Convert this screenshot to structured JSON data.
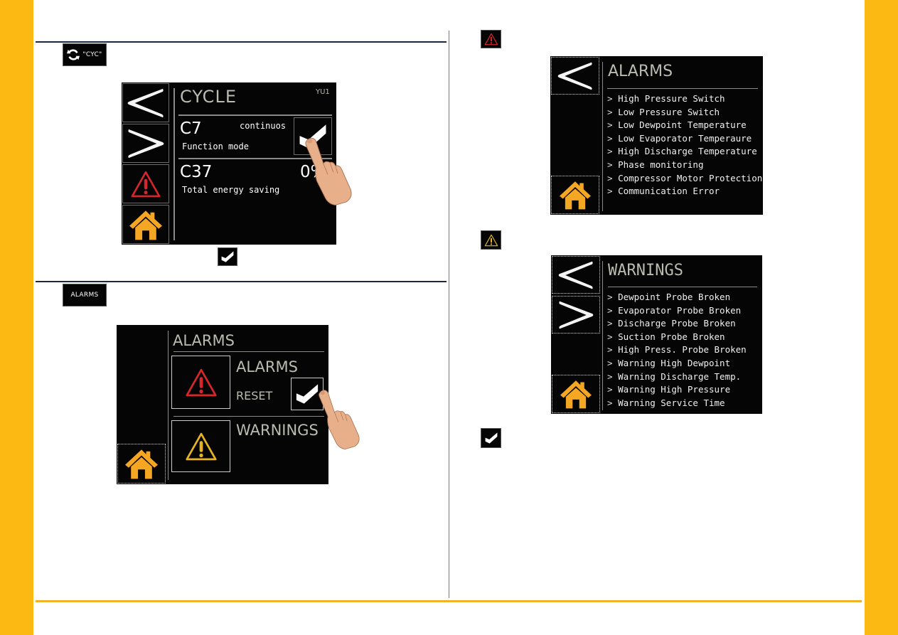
{
  "colors": {
    "accent_yellow": "#fdb913",
    "divider_navy": "#1b2842",
    "alarm_red": "#d8262c",
    "warning_yellow": "#e6b422",
    "home_amber": "#f5a623",
    "screen_bg": "#050505",
    "title_gray": "#b9bcae"
  },
  "section_cycle": {
    "chip_icon": "refresh-icon",
    "chip_label": "\"CYC\"",
    "screen": {
      "title": "CYCLE",
      "unit_id": "YU1",
      "rows": [
        {
          "code": "C7",
          "value": "continuos",
          "description": "Function mode"
        },
        {
          "code": "C37",
          "value": "0%",
          "description": "Total energy saving"
        }
      ],
      "nav_buttons": [
        "back-arrow-icon",
        "forward-arrow-icon",
        "alarm-triangle-icon",
        "home-icon"
      ],
      "confirm_icon": "checkmark-icon"
    },
    "confirm_chip_icon": "checkmark-icon"
  },
  "section_alarms": {
    "chip_label": "ALARMS",
    "screen": {
      "title": "ALARMS",
      "alarms_label": "ALARMS",
      "reset_label": "RESET",
      "warnings_label": "WARNINGS",
      "confirm_icon": "checkmark-icon"
    }
  },
  "alarms_list_screen": {
    "chip_icon": "alarm-triangle-icon",
    "title": "ALARMS",
    "items": [
      "High Pressure Switch",
      "Low Pressure Switch",
      "Low Dewpoint Temperature",
      "Low Evaporator Temperaure",
      "High Discharge Temperature",
      "Phase monitoring",
      "Compressor Motor Protection",
      "Communication Error"
    ]
  },
  "warnings_list_screen": {
    "chip_icon": "warning-triangle-icon",
    "title": "WARNINGS",
    "items": [
      "Dewpoint Probe Broken",
      "Evaporator Probe Broken",
      "Discharge Probe Broken",
      "Suction Probe Broken",
      "High Press. Probe Broken",
      "Warning High Dewpoint",
      "Warning Discharge Temp.",
      "Warning High Pressure",
      "Warning Service Time"
    ]
  },
  "final_confirm_icon": "checkmark-icon"
}
